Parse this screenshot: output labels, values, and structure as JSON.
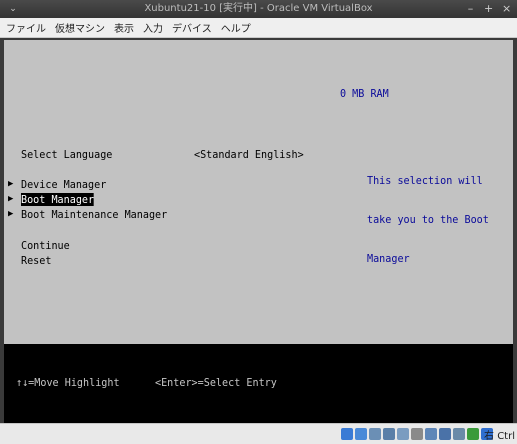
{
  "window": {
    "title": "Xubuntu21-10 [実行中] - Oracle VM VirtualBox",
    "menu_icon": "chevron-down-icon",
    "controls": [
      {
        "name": "minimize-button",
        "glyph": "–"
      },
      {
        "name": "maximize-button",
        "glyph": "+"
      },
      {
        "name": "close-button",
        "glyph": "×"
      }
    ]
  },
  "menubar": {
    "items": [
      "ファイル",
      "仮想マシン",
      "表示",
      "入力",
      "デバイス",
      "ヘルプ"
    ]
  },
  "bios": {
    "ram": "0 MB RAM",
    "language_label": "Select Language",
    "language_value": "<Standard English>",
    "help_lines": [
      "This selection will",
      "take you to the Boot",
      "Manager"
    ],
    "menu": [
      {
        "label": "Device Manager",
        "arrow": "▶",
        "selected": false
      },
      {
        "label": "Boot Manager",
        "arrow": "▶",
        "selected": true
      },
      {
        "label": "Boot Maintenance Manager",
        "arrow": "▶",
        "selected": false
      }
    ],
    "continue": "Continue",
    "reset": "Reset",
    "footer": {
      "move": "↑↓=Move Highlight",
      "select": "<Enter>=Select Entry"
    },
    "colors": {
      "background": "#c2c2c2",
      "help_text": "#0a0a9a",
      "footer_bg": "#000000",
      "footer_text": "#c6c6c6"
    }
  },
  "statusbar": {
    "icons": [
      {
        "name": "hard-disk-icon",
        "color": "#3a7bd5"
      },
      {
        "name": "optical-drive-icon",
        "color": "#4a8ad8"
      },
      {
        "name": "audio-icon",
        "color": "#6b8fb5"
      },
      {
        "name": "network-icon",
        "color": "#5a7fa8"
      },
      {
        "name": "usb-icon",
        "color": "#7a9cc0"
      },
      {
        "name": "shared-folders-icon",
        "color": "#8a8a8a"
      },
      {
        "name": "display-icon",
        "color": "#5e86b8"
      },
      {
        "name": "video-capture-icon",
        "color": "#4a72a8"
      },
      {
        "name": "cpu-icon",
        "color": "#6a8aa8"
      },
      {
        "name": "guest-additions-icon",
        "color": "#3a9a3a"
      },
      {
        "name": "mouse-integration-icon",
        "color": "#2f6fd0"
      }
    ],
    "host_key": "右 Ctrl"
  }
}
